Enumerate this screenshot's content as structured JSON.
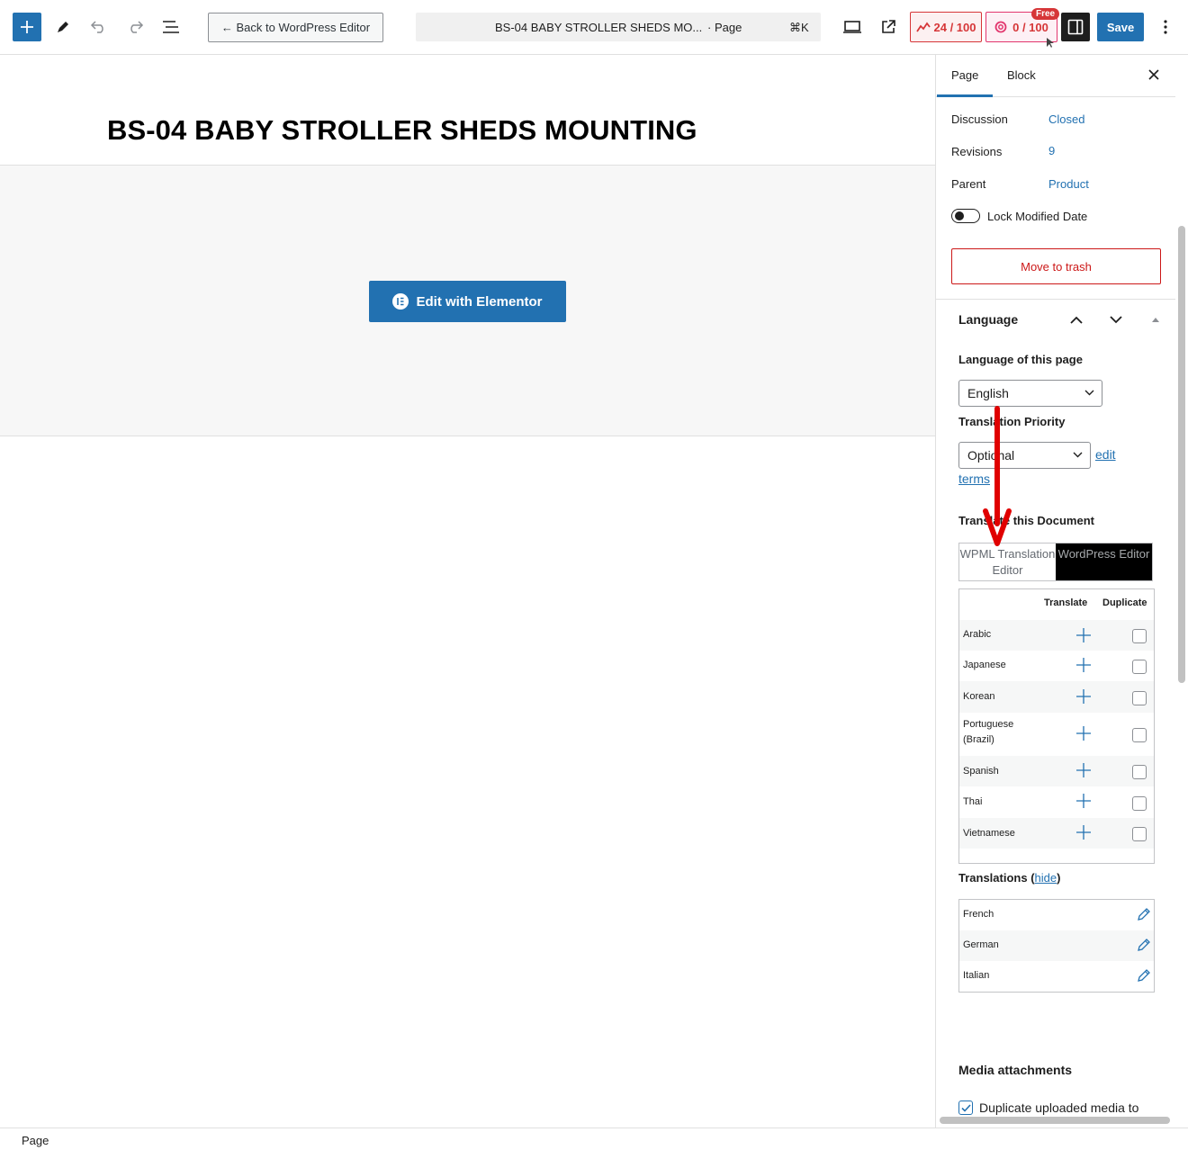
{
  "topbar": {
    "back_label": "← Back to WordPress Editor",
    "doc_title": "BS-04 BABY STROLLER SHEDS MO...",
    "doc_type": "· Page",
    "shortcut": "⌘K",
    "score_seo": "24 / 100",
    "score_readability": "0 / 100",
    "free_badge": "Free",
    "save_label": "Save"
  },
  "canvas": {
    "title": "BS-04 BABY STROLLER SHEDS MOUNTING",
    "elementor_label": "Edit with Elementor"
  },
  "sidebar": {
    "tabs": [
      "Page",
      "Block"
    ],
    "rows": [
      {
        "label": "Discussion",
        "value": "Closed"
      },
      {
        "label": "Revisions",
        "value": "9"
      },
      {
        "label": "Parent",
        "value": "Product"
      }
    ],
    "lock_label": "Lock Modified Date",
    "trash_label": "Move to trash",
    "language": {
      "heading": "Language",
      "lang_label": "Language of this page",
      "lang_value": "English",
      "priority_label": "Translation Priority",
      "priority_value": "Optional",
      "edit_link_1": "edit",
      "edit_link_2": "terms",
      "translate_doc_label": "Translate this Document",
      "editor_a": "WPML Translation Editor",
      "editor_b": "WordPress Editor",
      "col_translate": "Translate",
      "col_duplicate": "Duplicate",
      "languages": [
        "Arabic",
        "Japanese",
        "Korean",
        "Portuguese (Brazil)",
        "Spanish",
        "Thai",
        "Vietnamese"
      ],
      "translations_label": "Translations",
      "hide_link": "hide",
      "translations": [
        "French",
        "German",
        "Italian"
      ]
    },
    "media": {
      "heading": "Media attachments",
      "option": "Duplicate uploaded media to"
    }
  },
  "footer": {
    "breadcrumb": "Page"
  },
  "colors": {
    "accent": "#2271b1",
    "danger": "#cc1818",
    "arrow": "#e00000"
  }
}
